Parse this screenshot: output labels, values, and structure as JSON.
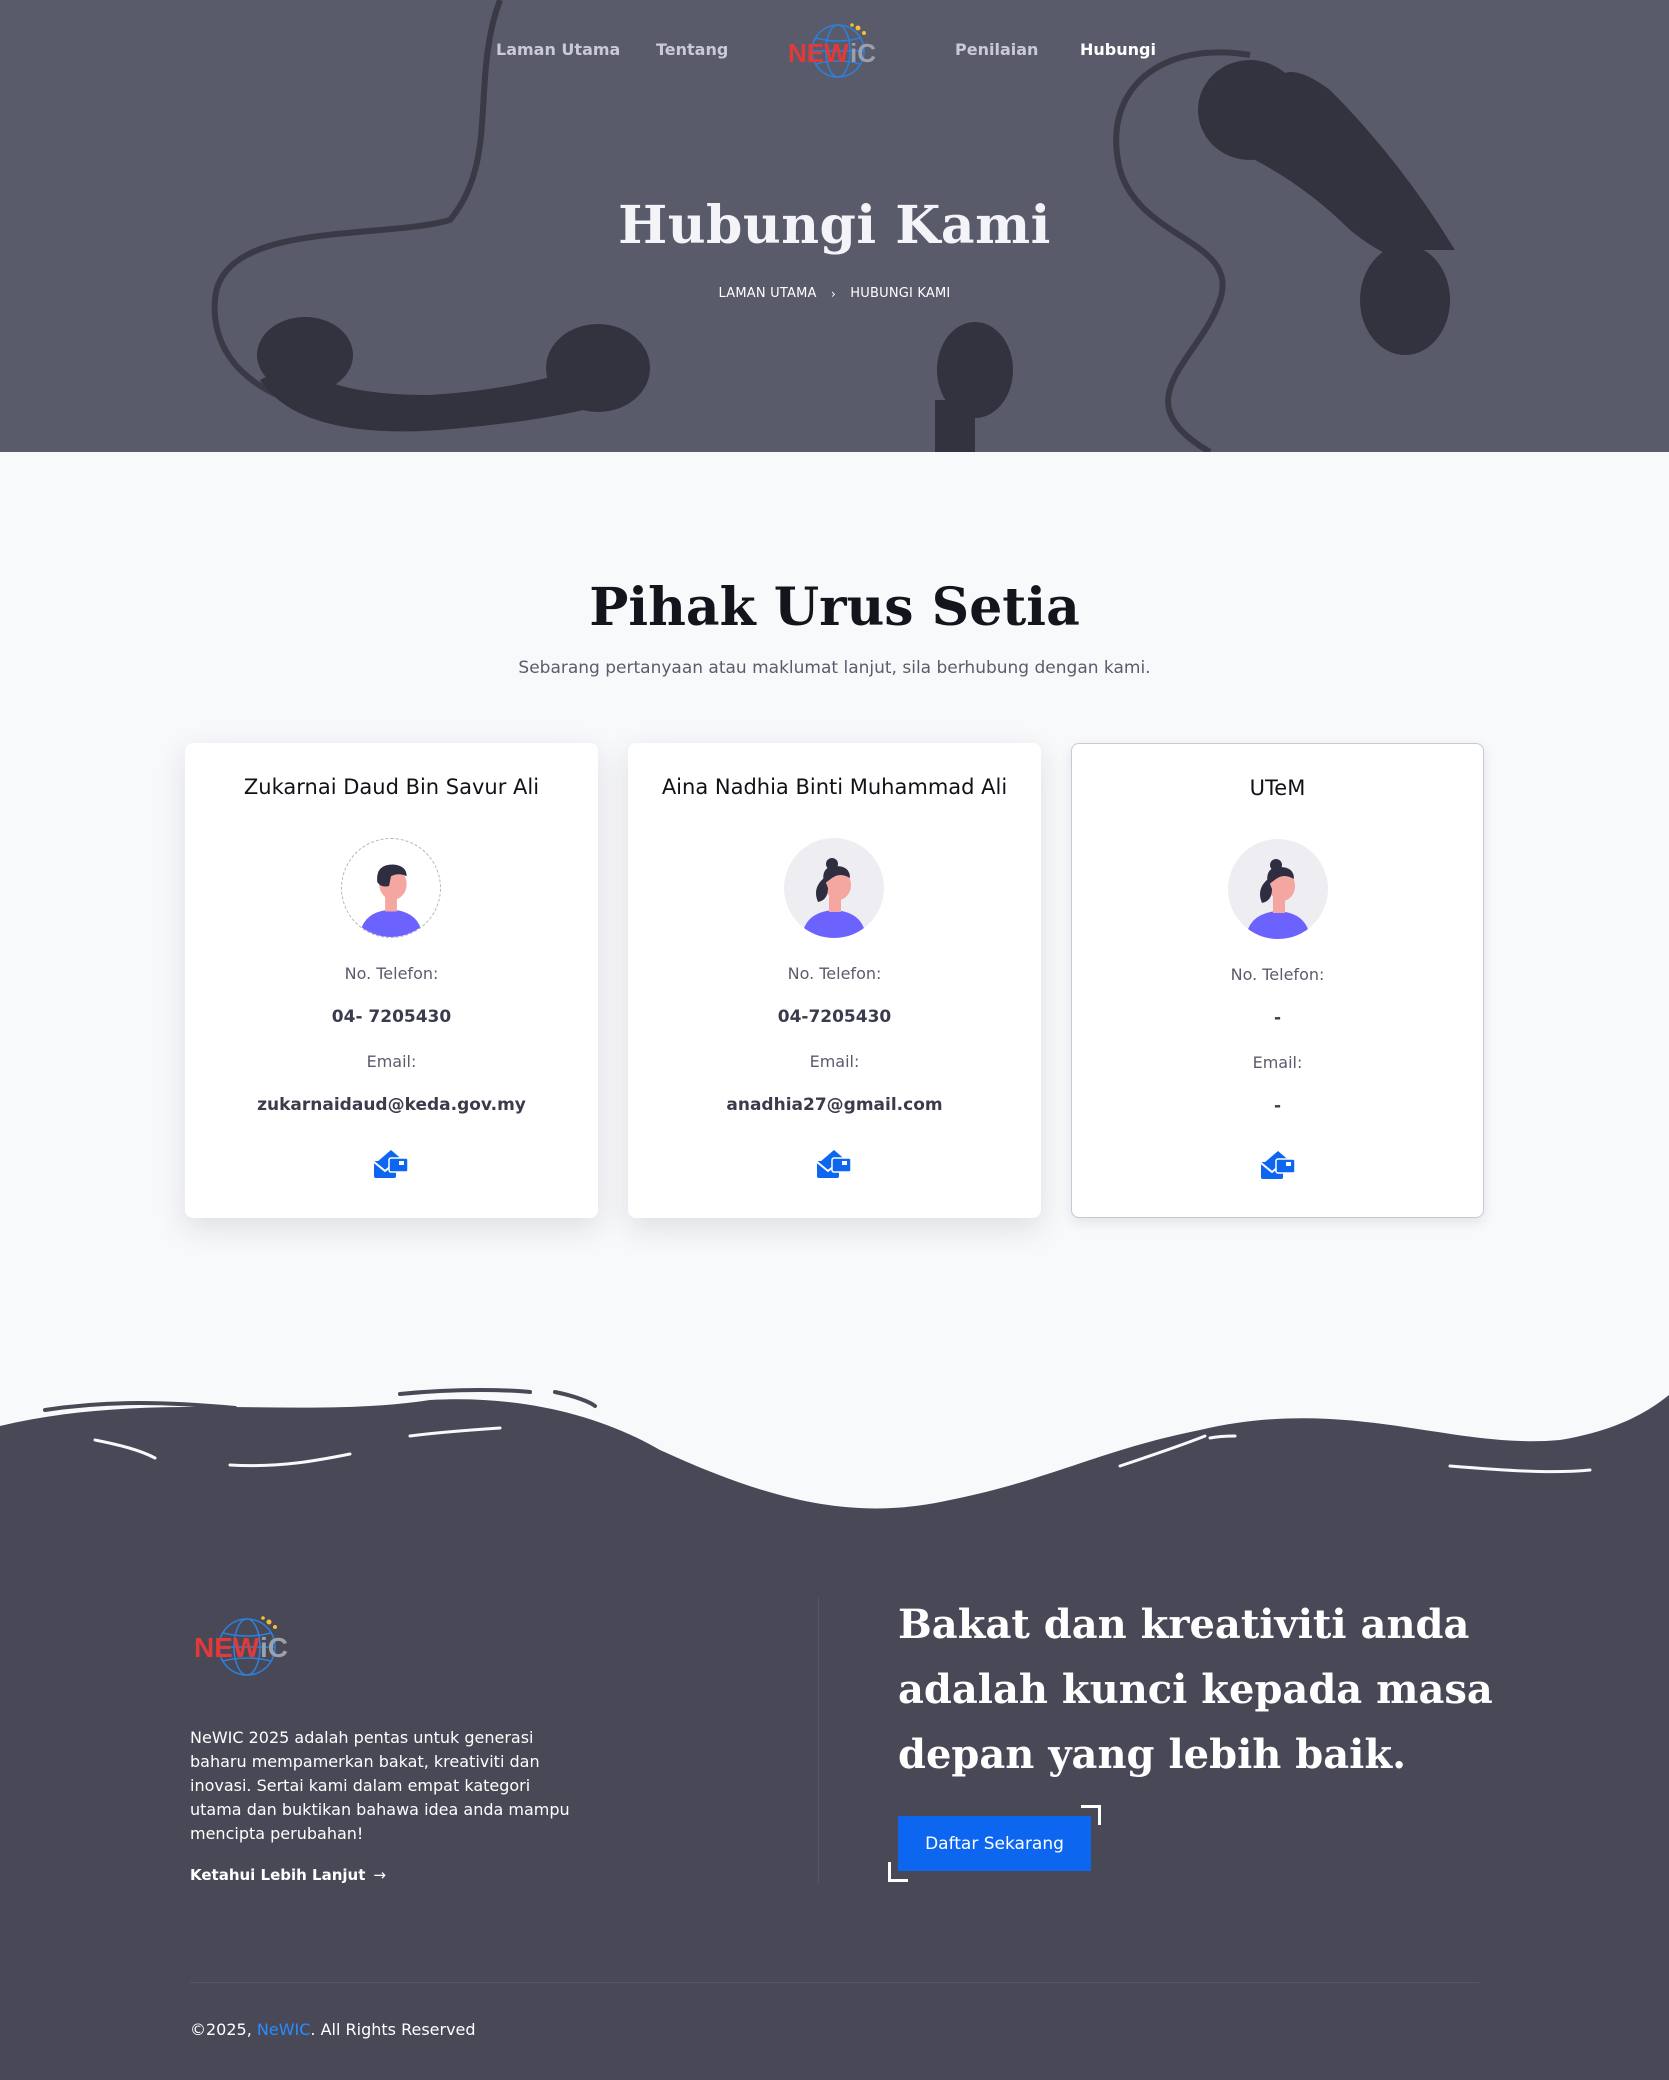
{
  "colors": {
    "hero_bg": "#595a6a",
    "footer_bg": "#484857",
    "accent_blue": "#0d66f0",
    "brand_blue": "#2a8cff",
    "logo_red": "#e03a3a",
    "logo_blue": "#2f7fd6"
  },
  "nav": {
    "items": [
      {
        "label": "Laman Utama",
        "active": false
      },
      {
        "label": "Tentang",
        "active": false
      },
      {
        "label": "Penilaian",
        "active": false
      },
      {
        "label": "Hubungi",
        "active": true
      }
    ],
    "logo": {
      "text_red": "NEW",
      "text_grey": "iC",
      "icon": "globe-logo-icon"
    }
  },
  "hero": {
    "title": "Hubungi Kami",
    "breadcrumb": [
      "LAMAN UTAMA",
      "HUBUNGI KAMI"
    ],
    "breadcrumb_separator_icon": "chevron-right-icon"
  },
  "section": {
    "title": "Pihak Urus Setia",
    "subtitle": "Sebarang pertanyaan atau maklumat lanjut, sila berhubung dengan kami."
  },
  "cards": [
    {
      "name": "Zukarnai Daud Bin Savur Ali",
      "avatar": "male-avatar-icon",
      "phone_label": "No. Telefon:",
      "phone": "04- 7205430",
      "email_label": "Email:",
      "email": "zukarnaidaud@keda.gov.my",
      "action_icon": "mail-contact-icon"
    },
    {
      "name": "Aina Nadhia Binti Muhammad Ali",
      "avatar": "female-avatar-icon",
      "phone_label": "No. Telefon:",
      "phone": "04-7205430",
      "email_label": "Email:",
      "email": "anadhia27@gmail.com",
      "action_icon": "mail-contact-icon"
    },
    {
      "name": "UTeM",
      "avatar": "female-avatar-icon",
      "phone_label": "No. Telefon:",
      "phone": "-",
      "email_label": "Email:",
      "email": "-",
      "action_icon": "mail-contact-icon"
    }
  ],
  "footer": {
    "about": "NeWIC 2025 adalah pentas untuk generasi baharu mempamerkan bakat, kreativiti dan inovasi. Sertai kami dalam empat kategori utama dan buktikan bahawa idea anda mampu mencipta perubahan!",
    "learn_more": "Ketahui Lebih Lanjut",
    "learn_more_icon": "arrow-right-icon",
    "quote": "Bakat dan kreativiti anda adalah kunci kepada masa depan yang lebih baik.",
    "cta": "Daftar Sekarang",
    "copyright_prefix": "©2025, ",
    "copyright_brand": "NeWIC",
    "copyright_suffix": ". All Rights Reserved"
  }
}
